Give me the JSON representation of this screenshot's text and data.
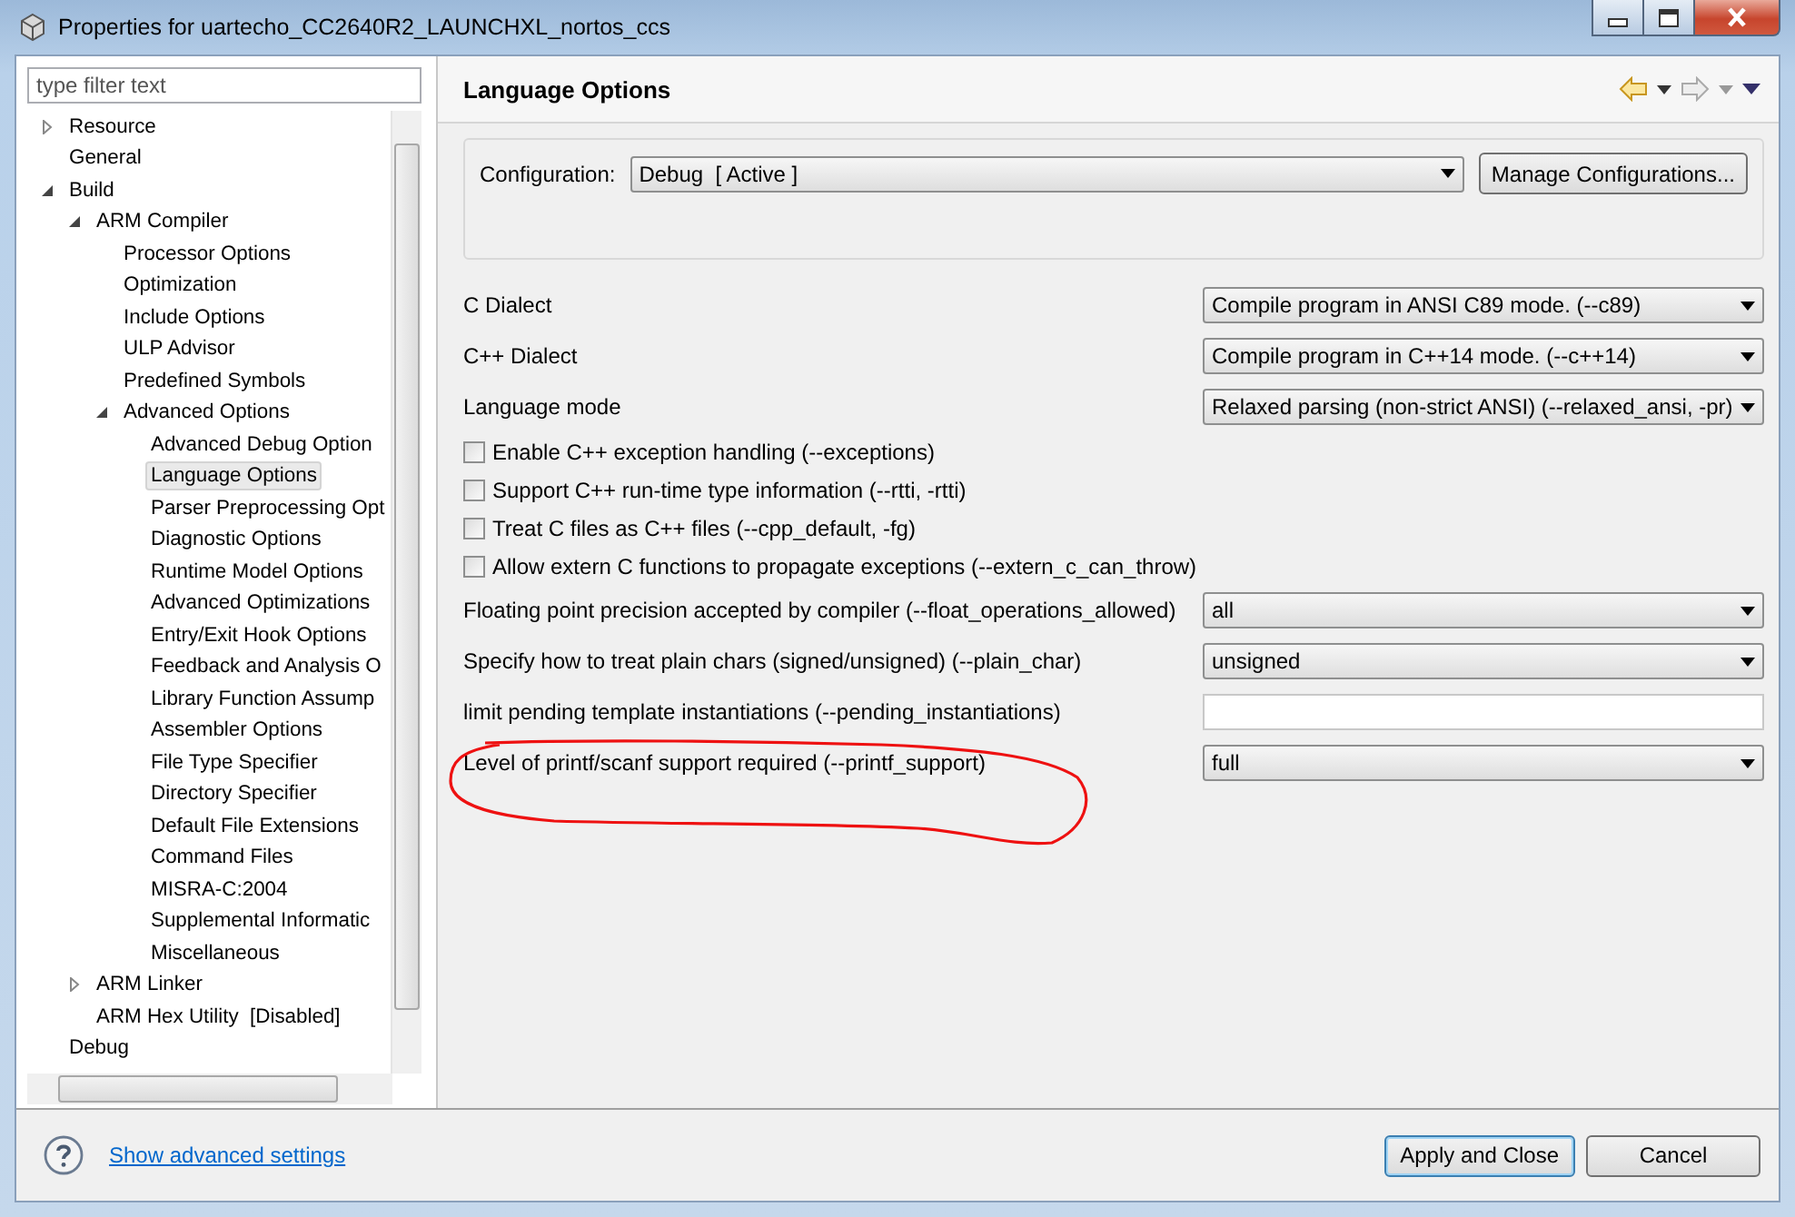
{
  "window": {
    "title": "Properties for uartecho_CC2640R2_LAUNCHXL_nortos_ccs"
  },
  "filter": {
    "placeholder": "type filter text"
  },
  "tree": [
    {
      "label": "Resource",
      "expanded": false,
      "selected": false
    },
    {
      "label": "General",
      "selected": false
    },
    {
      "label": "Build",
      "expanded": true,
      "selected": false,
      "children": [
        {
          "label": "ARM Compiler",
          "expanded": true,
          "selected": false,
          "children": [
            {
              "label": "Processor Options",
              "selected": false
            },
            {
              "label": "Optimization",
              "selected": false
            },
            {
              "label": "Include Options",
              "selected": false
            },
            {
              "label": "ULP Advisor",
              "selected": false
            },
            {
              "label": "Predefined Symbols",
              "selected": false
            },
            {
              "label": "Advanced Options",
              "expanded": true,
              "selected": false,
              "children": [
                {
                  "label": "Advanced Debug Option",
                  "selected": false
                },
                {
                  "label": "Language Options",
                  "selected": true
                },
                {
                  "label": "Parser Preprocessing Opt",
                  "selected": false
                },
                {
                  "label": "Diagnostic Options",
                  "selected": false
                },
                {
                  "label": "Runtime Model Options",
                  "selected": false
                },
                {
                  "label": "Advanced Optimizations",
                  "selected": false
                },
                {
                  "label": "Entry/Exit Hook Options",
                  "selected": false
                },
                {
                  "label": "Feedback and Analysis O",
                  "selected": false
                },
                {
                  "label": "Library Function Assump",
                  "selected": false
                },
                {
                  "label": "Assembler Options",
                  "selected": false
                },
                {
                  "label": "File Type Specifier",
                  "selected": false
                },
                {
                  "label": "Directory Specifier",
                  "selected": false
                },
                {
                  "label": "Default File Extensions",
                  "selected": false
                },
                {
                  "label": "Command Files",
                  "selected": false
                },
                {
                  "label": "MISRA-C:2004",
                  "selected": false
                },
                {
                  "label": "Supplemental Informatic",
                  "selected": false
                },
                {
                  "label": "Miscellaneous",
                  "selected": false
                }
              ]
            }
          ]
        },
        {
          "label": "ARM Linker",
          "expanded": false,
          "selected": false
        },
        {
          "label": "ARM Hex Utility  [Disabled]",
          "selected": false
        }
      ]
    },
    {
      "label": "Debug",
      "selected": false
    }
  ],
  "page": {
    "title": "Language Options"
  },
  "configuration": {
    "label": "Configuration:",
    "value": "Debug  [ Active ]",
    "button": "Manage Configurations..."
  },
  "options": [
    {
      "kind": "select",
      "label": "C Dialect",
      "value": "Compile program in ANSI C89 mode. (--c89)"
    },
    {
      "kind": "select",
      "label": "C++ Dialect",
      "value": "Compile program in C++14 mode. (--c++14)"
    },
    {
      "kind": "select",
      "label": "Language mode",
      "value": "Relaxed parsing (non-strict ANSI) (--relaxed_ansi, -pr)"
    },
    {
      "kind": "checkbox",
      "label": "Enable C++ exception handling (--exceptions)",
      "checked": false
    },
    {
      "kind": "checkbox",
      "label": "Support C++ run-time type information (--rtti, -rtti)",
      "checked": false
    },
    {
      "kind": "checkbox",
      "label": "Treat C files as C++ files (--cpp_default, -fg)",
      "checked": false
    },
    {
      "kind": "checkbox",
      "label": "Allow extern C functions to propagate exceptions (--extern_c_can_throw)",
      "checked": false
    },
    {
      "kind": "select",
      "label": "Floating point precision accepted by compiler (--float_operations_allowed)",
      "value": "all"
    },
    {
      "kind": "select",
      "label": "Specify how to treat plain chars (signed/unsigned) (--plain_char)",
      "value": "unsigned"
    },
    {
      "kind": "text",
      "label": "limit pending template instantiations (--pending_instantiations)"
    },
    {
      "kind": "select",
      "label": "Level of printf/scanf support required (--printf_support)",
      "value": "full"
    }
  ],
  "footer": {
    "link": "Show advanced settings",
    "buttons": [
      {
        "label": "Apply and Close",
        "default": true
      },
      {
        "label": "Cancel",
        "default": false
      }
    ]
  }
}
